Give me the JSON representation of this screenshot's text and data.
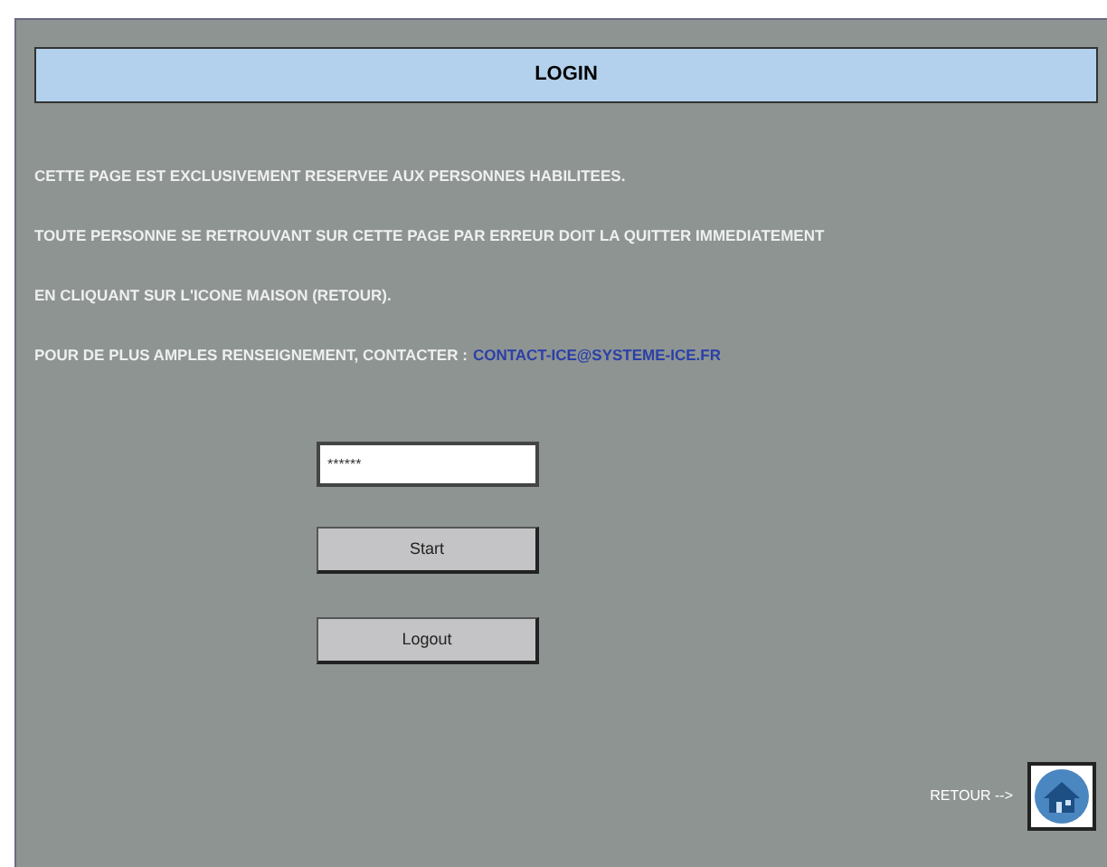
{
  "header": {
    "title": "LOGIN"
  },
  "notice_lines": [
    "CETTE PAGE EST EXCLUSIVEMENT RESERVEE AUX PERSONNES HABILITEES.",
    "TOUTE PERSONNE SE RETROUVANT SUR CETTE PAGE PAR ERREUR DOIT LA QUITTER IMMEDIATEMENT",
    "EN CLIQUANT SUR L'ICONE MAISON (RETOUR)."
  ],
  "contact": {
    "label": "POUR DE PLUS AMPLES RENSEIGNEMENT, CONTACTER :",
    "email": "CONTACT-ICE@SYSTEME-ICE.FR"
  },
  "password_field": {
    "value": "******"
  },
  "buttons": [
    {
      "label": "Start"
    },
    {
      "label": "Logout"
    }
  ],
  "return": {
    "label": "RETOUR -->"
  }
}
